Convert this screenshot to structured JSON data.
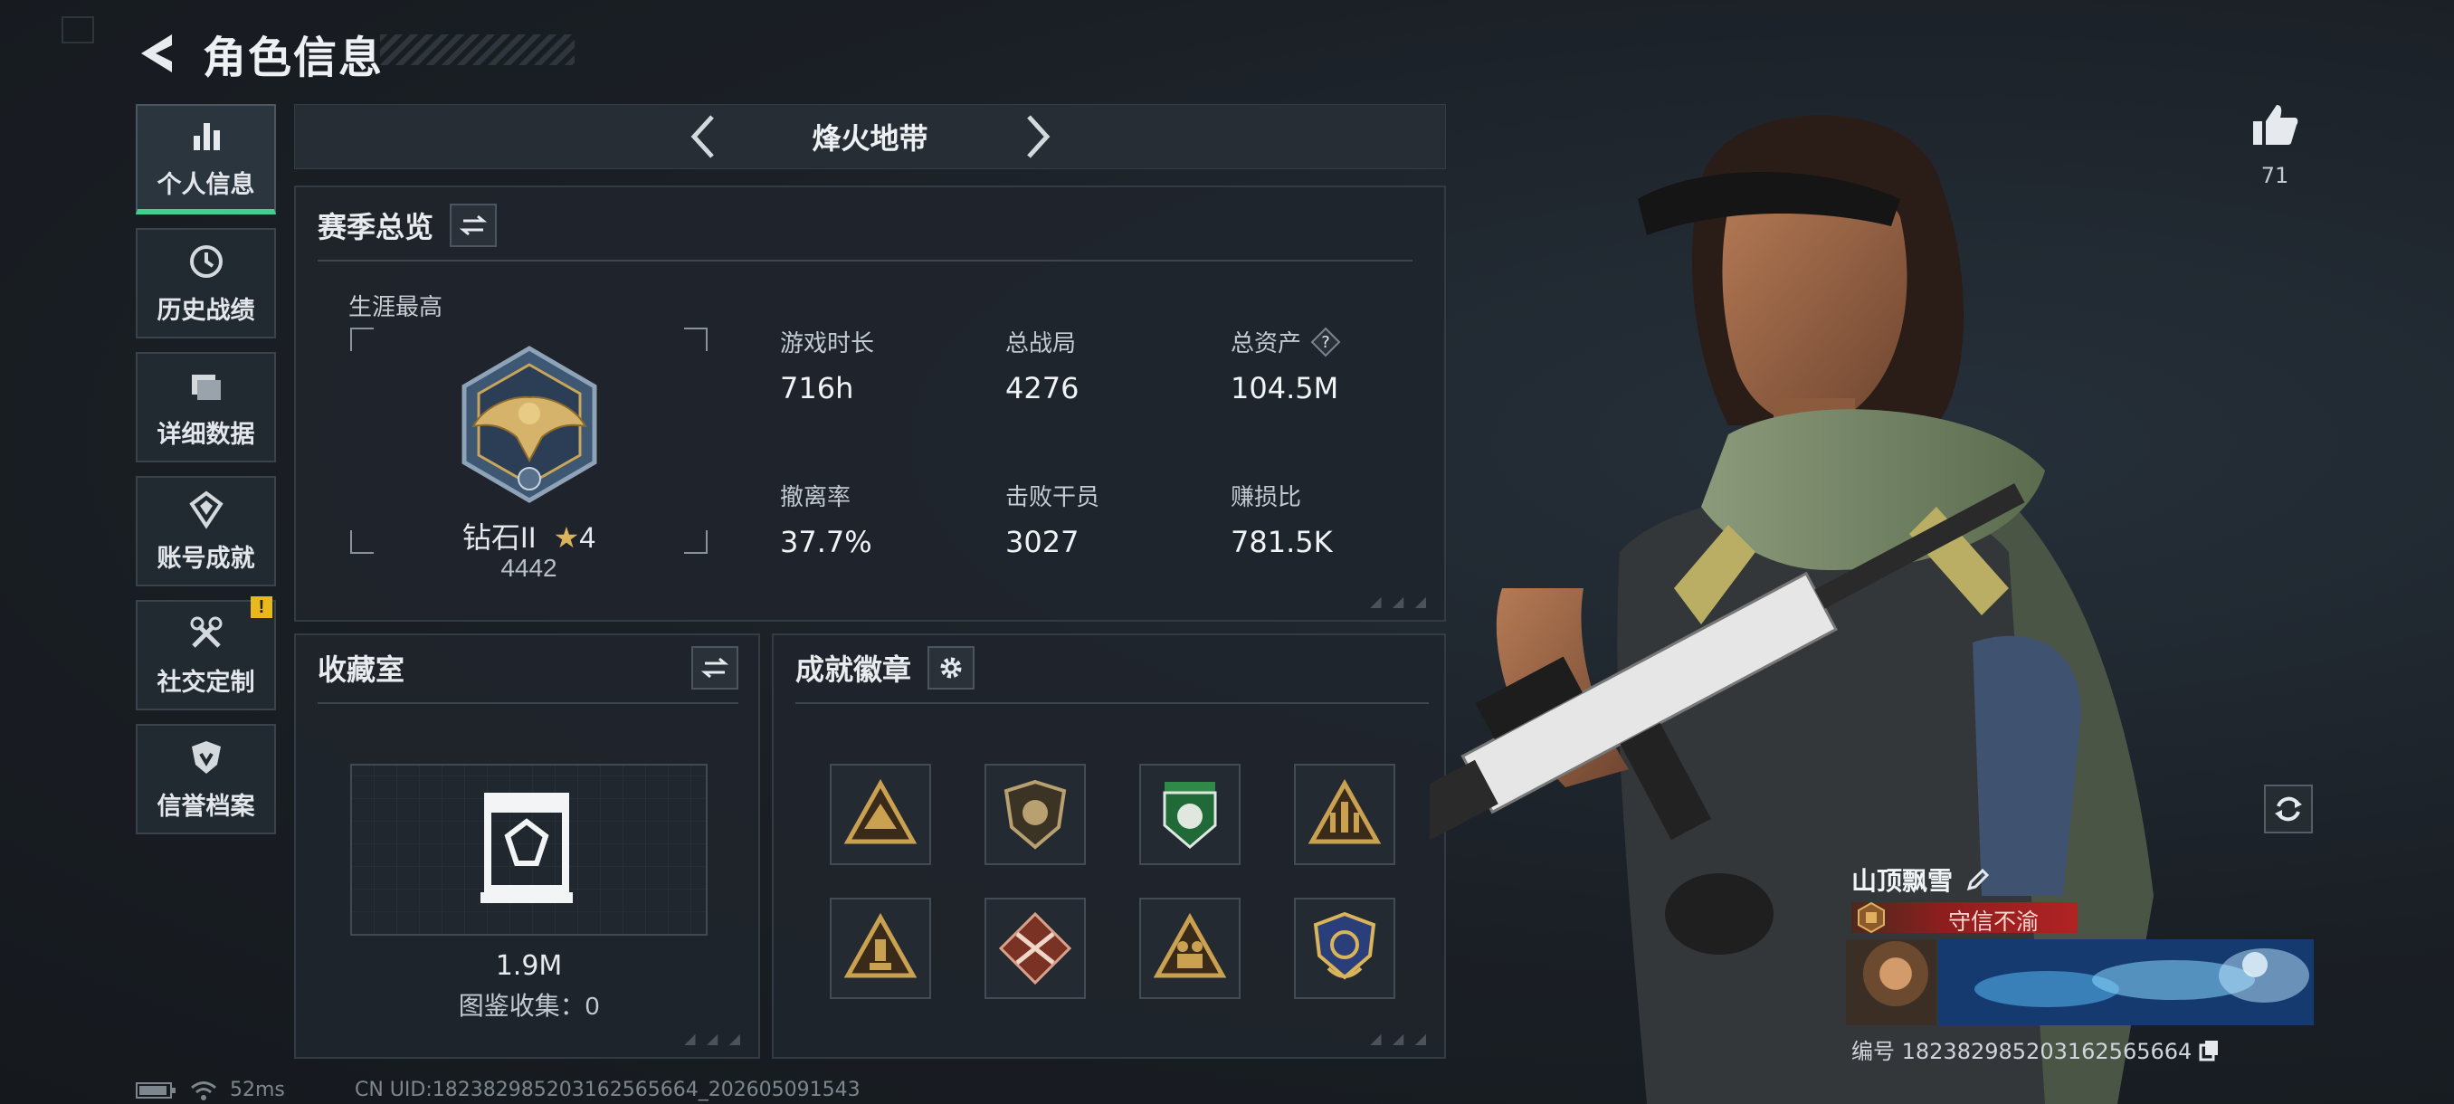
{
  "header": {
    "title": "角色信息"
  },
  "nav": {
    "items": [
      {
        "label": "个人信息",
        "icon": "bar-chart-icon",
        "active": true
      },
      {
        "label": "历史战绩",
        "icon": "history-icon"
      },
      {
        "label": "详细数据",
        "icon": "folder-icon"
      },
      {
        "label": "账号成就",
        "icon": "achievement-icon"
      },
      {
        "label": "社交定制",
        "icon": "tools-icon",
        "badge": "!"
      },
      {
        "label": "信誉档案",
        "icon": "shield-icon"
      }
    ]
  },
  "mode": {
    "name": "烽火地带"
  },
  "season": {
    "title": "赛季总览",
    "career_label": "生涯最高",
    "rank_name": "钻石II",
    "rank_stars": "4",
    "rank_score": "4442",
    "stats": [
      {
        "label": "游戏时长",
        "value": "716h"
      },
      {
        "label": "总战局",
        "value": "4276"
      },
      {
        "label": "总资产",
        "value": "104.5M",
        "help": "?"
      },
      {
        "label": "撤离率",
        "value": "37.7%"
      },
      {
        "label": "击败干员",
        "value": "3027"
      },
      {
        "label": "赚损比",
        "value": "781.5K"
      }
    ]
  },
  "collection": {
    "title": "收藏室",
    "value": "1.9M",
    "count_label": "图鉴收集：0"
  },
  "badges": {
    "title": "成就徽章",
    "items": [
      {
        "icon": "triangle-badge-icon",
        "color": "#c9a150"
      },
      {
        "icon": "shield-badge-icon",
        "color": "#b8a070"
      },
      {
        "icon": "green-crest-badge-icon",
        "color": "#2f8a4a"
      },
      {
        "icon": "rocket-badge-icon",
        "color": "#c9a150"
      },
      {
        "icon": "warning-badge-icon",
        "color": "#c9a150"
      },
      {
        "icon": "crossed-rifles-badge-icon",
        "color": "#b5523a"
      },
      {
        "icon": "soldiers-badge-icon",
        "color": "#c9a150"
      },
      {
        "icon": "blue-crest-badge-icon",
        "color": "#3b5aa8"
      }
    ]
  },
  "profile": {
    "likes": "71",
    "name": "山顶飘雪",
    "title_tag": "守信不渝",
    "id_text": "编号 182382985203162565664"
  },
  "status": {
    "ping": "52ms",
    "uid": "CN UID:182382985203162565664_202605091543"
  },
  "colors": {
    "accent": "#3fcf8e",
    "background": "#1b2026",
    "panel": "#1f252c"
  }
}
